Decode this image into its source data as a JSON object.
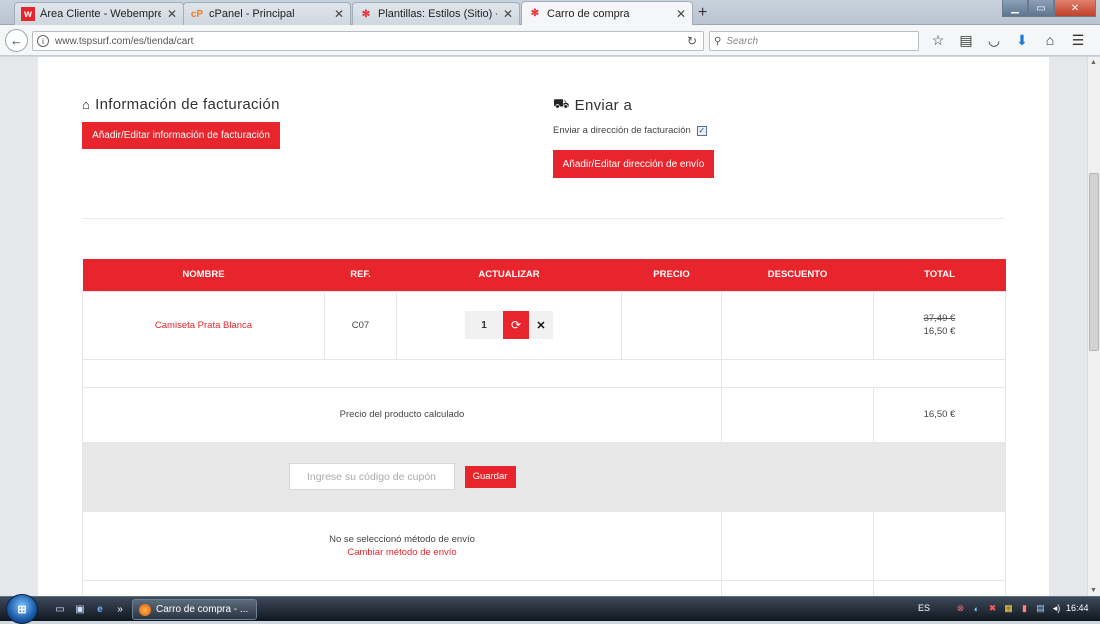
{
  "browser": {
    "tabs": [
      {
        "label": "Área Cliente - Webempres...",
        "favicon": "w"
      },
      {
        "label": "cPanel - Principal",
        "favicon": "cp"
      },
      {
        "label": "Plantillas: Estilos (Sitio) - T...",
        "favicon": "joomla"
      },
      {
        "label": "Carro de compra",
        "favicon": "joomla",
        "active": true
      }
    ],
    "new_tab": "+",
    "url": "www.tspsurf.com/es/tienda/cart",
    "search_placeholder": "Search"
  },
  "billing": {
    "title": "Información de facturación",
    "button": "Añadir/Editar información de facturación"
  },
  "shipping": {
    "title": "Enviar a",
    "same_address_label": "Enviar a dirección de facturación",
    "same_address_checked": true,
    "button": "Añadir/Editar dirección de envío"
  },
  "cart": {
    "headers": [
      "NOMBRE",
      "REF.",
      "ACTUALIZAR",
      "PRECIO",
      "DESCUENTO",
      "TOTAL"
    ],
    "items": [
      {
        "name": "Camiseta Prata Blanca",
        "ref": "C07",
        "quantity": "1",
        "old_total": "37,49 €",
        "total": "16,50 €"
      }
    ],
    "calc_label": "Precio del producto calculado",
    "calc_total": "16,50 €",
    "coupon_placeholder": "Ingrese su código de cupón",
    "coupon_button": "Guardar",
    "no_shipping": "No se seleccionó método de envío",
    "change_shipping": "Cambiar método de envío"
  },
  "taskbar": {
    "window_title": "Carro de compra - ...",
    "language": "ES",
    "time": "16:44"
  },
  "colors": {
    "accent": "#e8252c"
  }
}
